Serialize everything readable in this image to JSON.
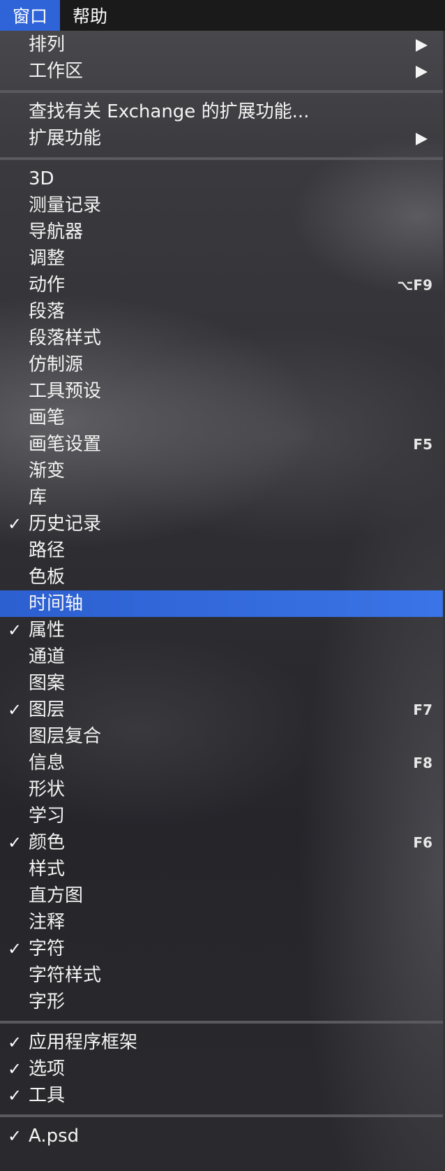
{
  "menubar": {
    "items": [
      {
        "label": "窗口",
        "active": true
      },
      {
        "label": "帮助",
        "active": false
      }
    ]
  },
  "menu": {
    "sections": [
      {
        "items": [
          {
            "label": "排列",
            "checked": false,
            "submenu": true,
            "shortcut": ""
          },
          {
            "label": "工作区",
            "checked": false,
            "submenu": true,
            "shortcut": ""
          }
        ]
      },
      {
        "items": [
          {
            "label": "查找有关 Exchange 的扩展功能...",
            "checked": false,
            "submenu": false,
            "shortcut": ""
          },
          {
            "label": "扩展功能",
            "checked": false,
            "submenu": true,
            "shortcut": ""
          }
        ]
      },
      {
        "items": [
          {
            "label": "3D",
            "checked": false,
            "submenu": false,
            "shortcut": ""
          },
          {
            "label": "测量记录",
            "checked": false,
            "submenu": false,
            "shortcut": ""
          },
          {
            "label": "导航器",
            "checked": false,
            "submenu": false,
            "shortcut": ""
          },
          {
            "label": "调整",
            "checked": false,
            "submenu": false,
            "shortcut": ""
          },
          {
            "label": "动作",
            "checked": false,
            "submenu": false,
            "shortcut": "⌥F9"
          },
          {
            "label": "段落",
            "checked": false,
            "submenu": false,
            "shortcut": ""
          },
          {
            "label": "段落样式",
            "checked": false,
            "submenu": false,
            "shortcut": ""
          },
          {
            "label": "仿制源",
            "checked": false,
            "submenu": false,
            "shortcut": ""
          },
          {
            "label": "工具预设",
            "checked": false,
            "submenu": false,
            "shortcut": ""
          },
          {
            "label": "画笔",
            "checked": false,
            "submenu": false,
            "shortcut": ""
          },
          {
            "label": "画笔设置",
            "checked": false,
            "submenu": false,
            "shortcut": "F5"
          },
          {
            "label": "渐变",
            "checked": false,
            "submenu": false,
            "shortcut": ""
          },
          {
            "label": "库",
            "checked": false,
            "submenu": false,
            "shortcut": ""
          },
          {
            "label": "历史记录",
            "checked": true,
            "submenu": false,
            "shortcut": ""
          },
          {
            "label": "路径",
            "checked": false,
            "submenu": false,
            "shortcut": ""
          },
          {
            "label": "色板",
            "checked": false,
            "submenu": false,
            "shortcut": ""
          },
          {
            "label": "时间轴",
            "checked": false,
            "submenu": false,
            "shortcut": "",
            "highlighted": true
          },
          {
            "label": "属性",
            "checked": true,
            "submenu": false,
            "shortcut": ""
          },
          {
            "label": "通道",
            "checked": false,
            "submenu": false,
            "shortcut": ""
          },
          {
            "label": "图案",
            "checked": false,
            "submenu": false,
            "shortcut": ""
          },
          {
            "label": "图层",
            "checked": true,
            "submenu": false,
            "shortcut": "F7"
          },
          {
            "label": "图层复合",
            "checked": false,
            "submenu": false,
            "shortcut": ""
          },
          {
            "label": "信息",
            "checked": false,
            "submenu": false,
            "shortcut": "F8"
          },
          {
            "label": "形状",
            "checked": false,
            "submenu": false,
            "shortcut": ""
          },
          {
            "label": "学习",
            "checked": false,
            "submenu": false,
            "shortcut": ""
          },
          {
            "label": "颜色",
            "checked": true,
            "submenu": false,
            "shortcut": "F6"
          },
          {
            "label": "样式",
            "checked": false,
            "submenu": false,
            "shortcut": ""
          },
          {
            "label": "直方图",
            "checked": false,
            "submenu": false,
            "shortcut": ""
          },
          {
            "label": "注释",
            "checked": false,
            "submenu": false,
            "shortcut": ""
          },
          {
            "label": "字符",
            "checked": true,
            "submenu": false,
            "shortcut": ""
          },
          {
            "label": "字符样式",
            "checked": false,
            "submenu": false,
            "shortcut": ""
          },
          {
            "label": "字形",
            "checked": false,
            "submenu": false,
            "shortcut": ""
          }
        ]
      },
      {
        "items": [
          {
            "label": "应用程序框架",
            "checked": true,
            "submenu": false,
            "shortcut": ""
          },
          {
            "label": "选项",
            "checked": true,
            "submenu": false,
            "shortcut": ""
          },
          {
            "label": "工具",
            "checked": true,
            "submenu": false,
            "shortcut": ""
          }
        ]
      },
      {
        "items": [
          {
            "label": "A.psd",
            "checked": true,
            "submenu": false,
            "shortcut": ""
          }
        ]
      }
    ],
    "check_glyph": "✓",
    "icons": {
      "check": "checkmark-icon",
      "submenu": "submenu-arrow-icon"
    },
    "colors": {
      "highlight": "#2f63d8",
      "menubar_active": "#2f63d8"
    }
  }
}
